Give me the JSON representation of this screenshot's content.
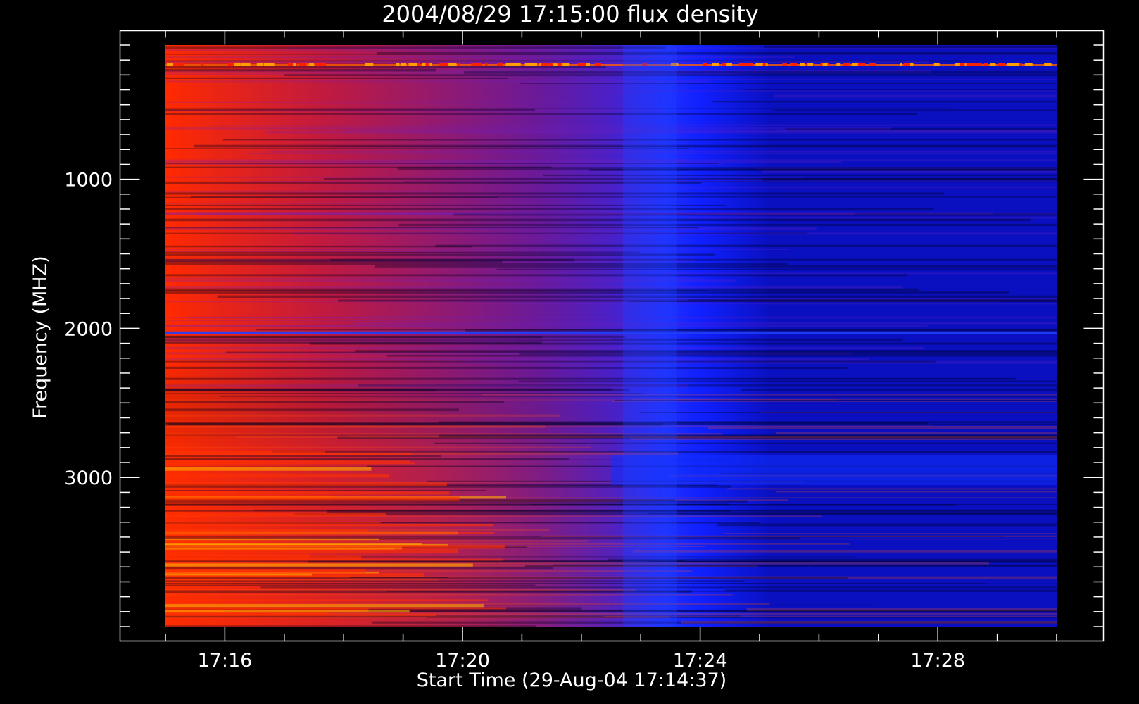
{
  "chart_data": {
    "type": "heatmap",
    "title": "2004/08/29 17:15:00 flux density",
    "xlabel": "Start Time (29-Aug-04 17:14:37)",
    "ylabel": "Frequency (MHZ)",
    "x_tick_labels": [
      "17:16",
      "17:20",
      "17:24",
      "17:28"
    ],
    "x_tick_minutes": [
      16,
      20,
      24,
      28
    ],
    "x_range_minutes": [
      15,
      30
    ],
    "y_tick_labels": [
      "1000",
      "2000",
      "3000"
    ],
    "y_tick_values": [
      1000,
      2000,
      3000
    ],
    "y_range": [
      100,
      4000
    ],
    "y_reversed": true,
    "grid": false,
    "colors": {
      "background": "#000000",
      "axes": "#ffffff",
      "low": "#0000ff",
      "mid": "#5a1a90",
      "high": "#ff2a00",
      "peak": "#ffb000"
    },
    "intensity_profile": {
      "time_minutes": [
        15,
        17,
        19,
        21,
        22,
        23,
        23.5,
        24,
        26,
        30
      ],
      "relative_level": [
        1.0,
        0.85,
        0.6,
        0.4,
        0.3,
        0.12,
        0.05,
        0.02,
        0.0,
        0.0
      ]
    }
  }
}
